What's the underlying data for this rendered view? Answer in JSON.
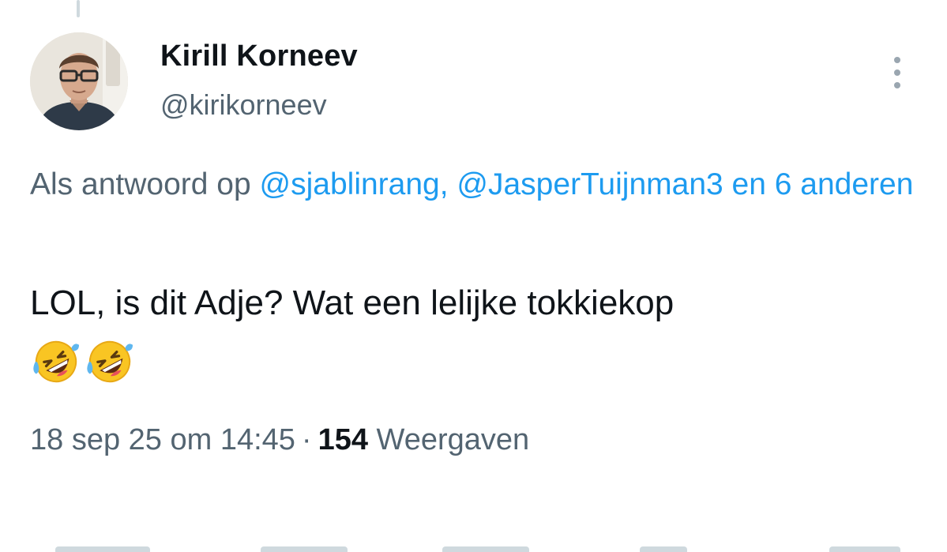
{
  "user": {
    "display_name": "Kirill Korneev",
    "handle": "@kirikorneev"
  },
  "reply_context": {
    "prefix": "Als antwoord op ",
    "mention_1": "@sjablinrang,",
    "mention_2": "@JasperTuijnman3",
    "others": "en 6 anderen"
  },
  "tweet": {
    "text": "LOL, is dit Adje? Wat een lelijke tokkiekop",
    "emojis": [
      "rolling-on-the-floor-laughing",
      "rolling-on-the-floor-laughing"
    ]
  },
  "meta": {
    "timestamp": "18 sep 25 om 14:45",
    "separator": "·",
    "views_count": "154",
    "views_label": "Weergaven"
  },
  "colors": {
    "link": "#1d9bf0",
    "primary_text": "#0f1419",
    "secondary_text": "#536471"
  },
  "icons": {
    "more": "more-vertical-icon"
  }
}
